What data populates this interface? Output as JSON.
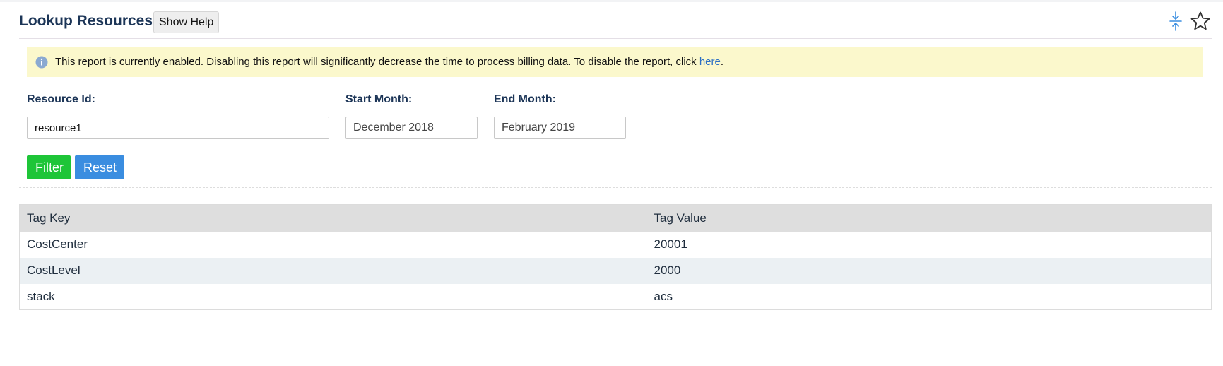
{
  "header": {
    "title": "Lookup Resources",
    "help_label": "Show Help",
    "collapse_icon": "collapse-vertical-icon",
    "favorite_icon": "star-outline-icon",
    "accent_color": "#3a8de0"
  },
  "notice": {
    "icon": "info-icon",
    "text_before": "This report is currently enabled. Disabling this report will significantly decrease the time to process billing data. To disable the report, click ",
    "link_text": "here",
    "text_after": ".",
    "background_color": "#fbf8cc"
  },
  "form": {
    "resource_id": {
      "label": "Resource Id:",
      "value": "resource1"
    },
    "start_month": {
      "label": "Start Month:",
      "value": "December 2018"
    },
    "end_month": {
      "label": "End Month:",
      "value": "February 2019"
    },
    "filter_label": "Filter",
    "reset_label": "Reset",
    "filter_color": "#1ec538",
    "reset_color": "#3a8de0"
  },
  "table": {
    "columns": [
      "Tag Key",
      "Tag Value"
    ],
    "rows": [
      [
        "CostCenter",
        "20001"
      ],
      [
        "CostLevel",
        "2000"
      ],
      [
        "stack",
        "acs"
      ]
    ]
  }
}
